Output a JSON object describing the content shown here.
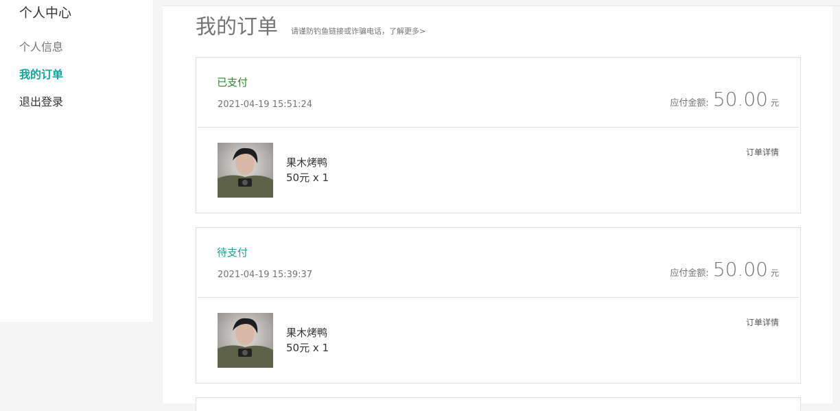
{
  "sidebar": {
    "title": "个人中心",
    "items": [
      {
        "label": "个人信息"
      },
      {
        "label": "我的订单"
      },
      {
        "label": "退出登录"
      }
    ]
  },
  "main": {
    "title": "我的订单",
    "notice": "请谨防钓鱼链接或诈骗电话，了解更多>",
    "orders": [
      {
        "status": "已支付",
        "time": "2021-04-19 15:51:24",
        "amount_label": "应付金额:",
        "amount": "50.00",
        "unit": "元",
        "product_name": "果木烤鸭",
        "product_price": "50元 x 1",
        "detail": "订单详情"
      },
      {
        "status": "待支付",
        "time": "2021-04-19 15:39:37",
        "amount_label": "应付金额:",
        "amount": "50.00",
        "unit": "元",
        "product_name": "果木烤鸭",
        "product_price": "50元 x 1",
        "detail": "订单详情"
      }
    ]
  },
  "colors": {
    "accent": "#1aa19c",
    "paid": "#2e8b2e"
  }
}
